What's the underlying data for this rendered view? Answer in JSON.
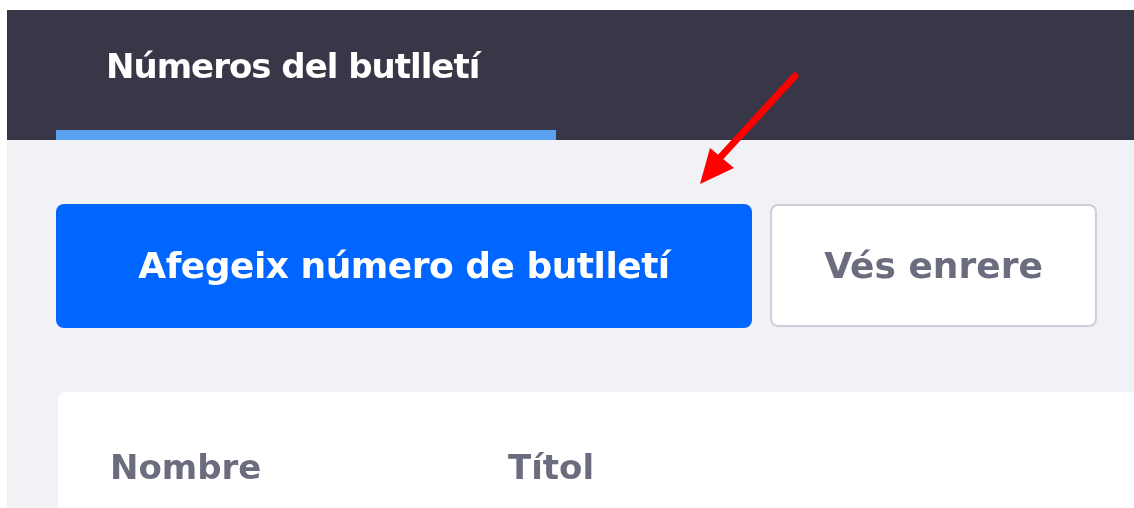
{
  "tabs": [
    {
      "label": "Números del butlletí",
      "selected": true
    }
  ],
  "actions": [
    {
      "label": "Afegeix número de butlletí",
      "kind": "primary"
    },
    {
      "label": "Vés enrere",
      "kind": "secondary"
    }
  ],
  "table": {
    "columns": [
      "Nombre",
      "Títol"
    ]
  }
}
